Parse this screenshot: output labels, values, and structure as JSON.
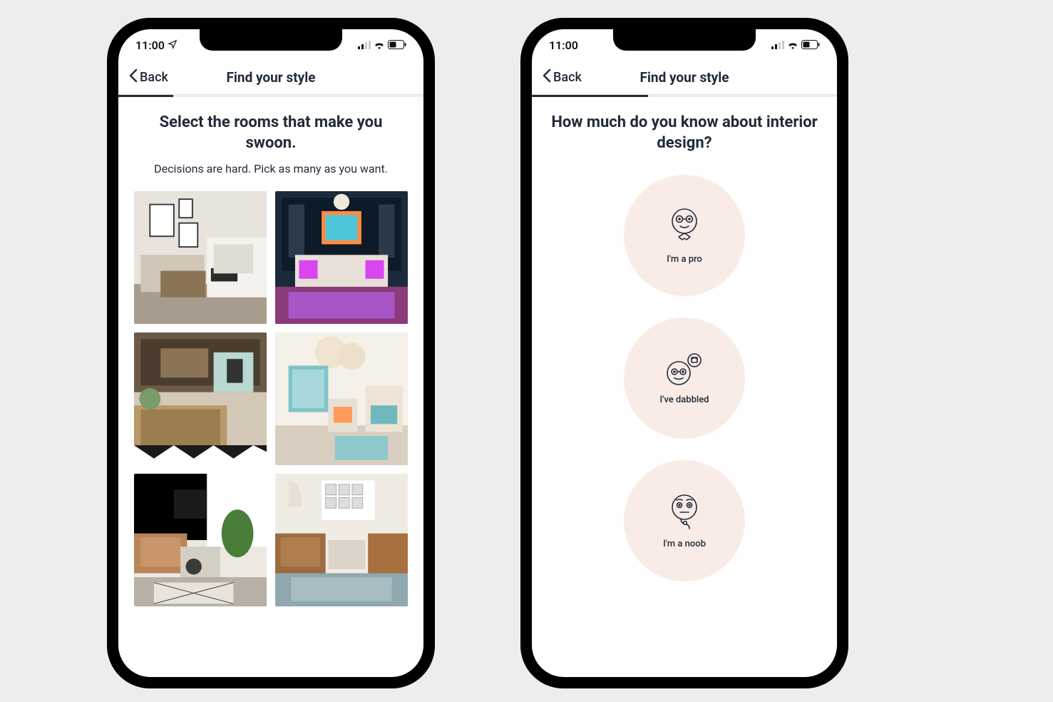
{
  "statusBar": {
    "time": "11:00",
    "locationIcon": "location-arrow-icon",
    "signalIcon": "signal-icon",
    "wifiIcon": "wifi-icon",
    "batteryIcon": "battery-icon"
  },
  "phoneLeft": {
    "nav": {
      "back": "Back",
      "title": "Find your style"
    },
    "progressPercent": 18,
    "heading": "Select the rooms that make you swoon.",
    "subheading": "Decisions are hard. Pick as many as you want.",
    "rooms": [
      {
        "name": "room-neutral-modern"
      },
      {
        "name": "room-eclectic-colorful"
      },
      {
        "name": "room-rustic-wood"
      },
      {
        "name": "room-bright-airy"
      },
      {
        "name": "room-mid-century"
      },
      {
        "name": "room-boho-leather"
      }
    ]
  },
  "phoneRight": {
    "nav": {
      "back": "Back",
      "title": "Find your style"
    },
    "progressPercent": 38,
    "heading": "How much do you know about interior design?",
    "options": [
      {
        "label": "I'm a pro",
        "icon": "pro-face-icon"
      },
      {
        "label": "I've dabbled",
        "icon": "dabbled-face-icon"
      },
      {
        "label": "I'm a noob",
        "icon": "noob-face-icon"
      }
    ]
  }
}
